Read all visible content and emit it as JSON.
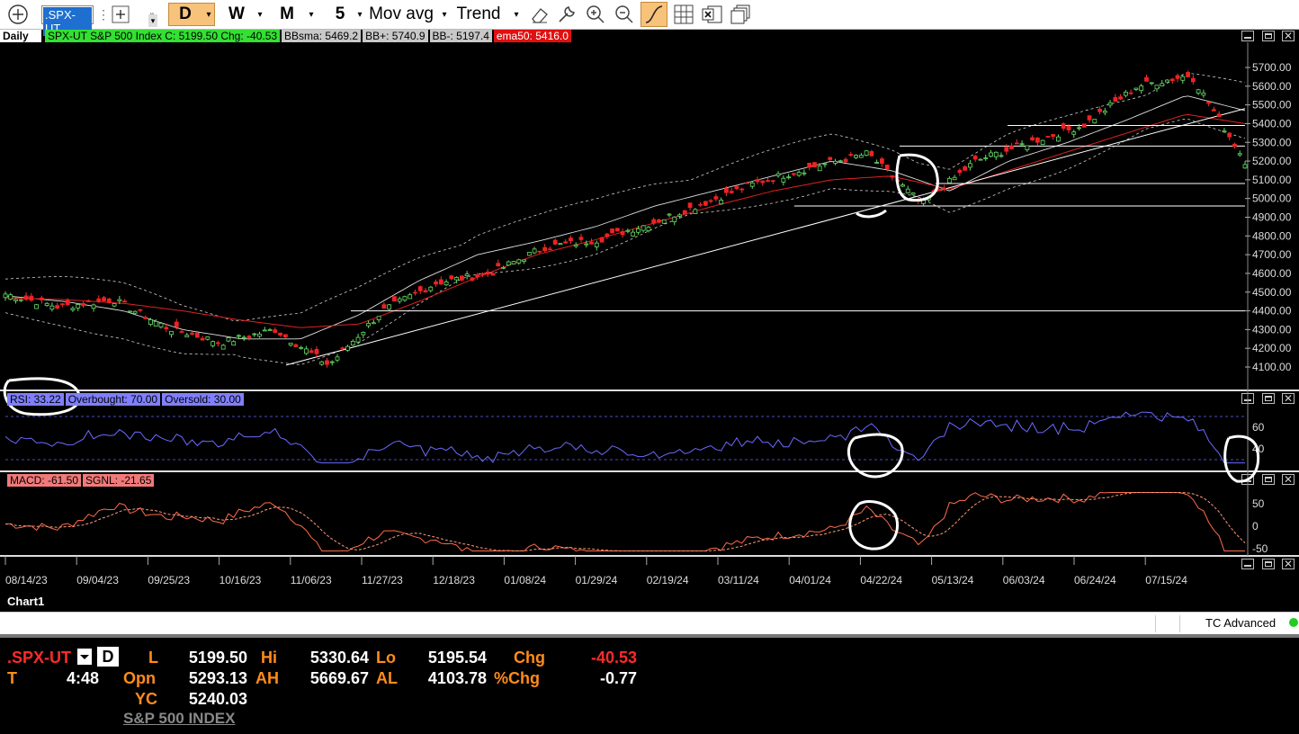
{
  "toolbar": {
    "symbol": ".SPX-UT",
    "period_d": "D",
    "period_w": "W",
    "period_m": "M",
    "interval": "5",
    "studies_label": "Mov avg",
    "trend_label": "Trend",
    "icons": [
      "add-icon",
      "frame-icon",
      "eraser-icon",
      "wrench-icon",
      "zoom-in-icon",
      "zoom-out-icon",
      "draw-line-icon",
      "grid-icon",
      "excel-icon",
      "windows-icon"
    ]
  },
  "chart_header": {
    "timeframe": "Daily",
    "quote_tag": "SPX-UT  S&P 500 Index  C: 5199.50  Chg: -40.53",
    "bbsma": "BBsma: 5469.2",
    "bbplus": "BB+: 5740.9",
    "bbminus": "BB-: 5197.4",
    "ema": "ema50: 5416.0",
    "colors": {
      "quote": "#00e000",
      "bb": "#bfbfbf",
      "ema": "#e00000"
    }
  },
  "rsi_header": {
    "rsi": "RSI: 33.22",
    "overbought": "Overbought: 70.00",
    "oversold": "Oversold: 30.00"
  },
  "macd_header": {
    "macd": "MACD: -61.50",
    "signal": "SGNL: -21.65"
  },
  "price_axis": [
    "5700.00",
    "5600.00",
    "5500.00",
    "5400.00",
    "5300.00",
    "5200.00",
    "5100.00",
    "5000.00",
    "4900.00",
    "4800.00",
    "4700.00",
    "4600.00",
    "4500.00",
    "4400.00",
    "4300.00",
    "4200.00",
    "4100.00"
  ],
  "rsi_axis": [
    "60",
    "40"
  ],
  "macd_axis": [
    "50",
    "0",
    "-50"
  ],
  "date_axis": [
    "08/14/23",
    "09/04/23",
    "09/25/23",
    "10/16/23",
    "11/06/23",
    "11/27/23",
    "12/18/23",
    "01/08/24",
    "01/29/24",
    "02/19/24",
    "03/11/24",
    "04/01/24",
    "04/22/24",
    "05/13/24",
    "06/03/24",
    "06/24/24",
    "07/15/24"
  ],
  "tabs": {
    "chart1": "Chart1",
    "tc_advanced": "TC Advanced"
  },
  "quote_panel": {
    "symbol": ".SPX-UT",
    "d_button": "D",
    "time_label": "T",
    "time_value": "4:48",
    "l_label": "L",
    "l_value": "5199.50",
    "opn_label": "Opn",
    "opn_value": "5293.13",
    "yc_label": "YC",
    "yc_value": "5240.03",
    "hi_label": "Hi",
    "hi_value": "5330.64",
    "ah_label": "AH",
    "ah_value": "5669.67",
    "lo_label": "Lo",
    "lo_value": "5195.54",
    "al_label": "AL",
    "al_value": "4103.78",
    "chg_label": "Chg",
    "chg_value": "-40.53",
    "pchg_label": "%Chg",
    "pchg_value": "-0.77",
    "name": "S&P 500 INDEX"
  },
  "chart_data": {
    "type": "line",
    "title": "SPX-UT S&P 500 Index",
    "x_range": [
      "08/14/23",
      "07/31/24"
    ],
    "ylim": [
      4050,
      5780
    ],
    "ylabel": "",
    "series": [
      {
        "name": "ema50",
        "values_approx": [
          4470,
          4460,
          4440,
          4400,
          4350,
          4310,
          4330,
          4450,
          4580,
          4700,
          4780,
          4870,
          4960,
          5040,
          5100,
          5120,
          5050,
          5150,
          5250,
          5350,
          5450,
          5400
        ]
      },
      {
        "name": "BBsma",
        "values_approx": [
          4480,
          4450,
          4400,
          4300,
          4250,
          4250,
          4380,
          4560,
          4700,
          4770,
          4850,
          4960,
          5040,
          5120,
          5200,
          5150,
          5040,
          5200,
          5300,
          5420,
          5550,
          5470
        ]
      }
    ],
    "price_approx": [
      4490,
      4420,
      4460,
      4310,
      4230,
      4300,
      4110,
      4400,
      4550,
      4600,
      4740,
      4780,
      4870,
      4980,
      5090,
      5170,
      5240,
      4970,
      5200,
      5300,
      5390,
      5600,
      5660,
      5200
    ]
  }
}
